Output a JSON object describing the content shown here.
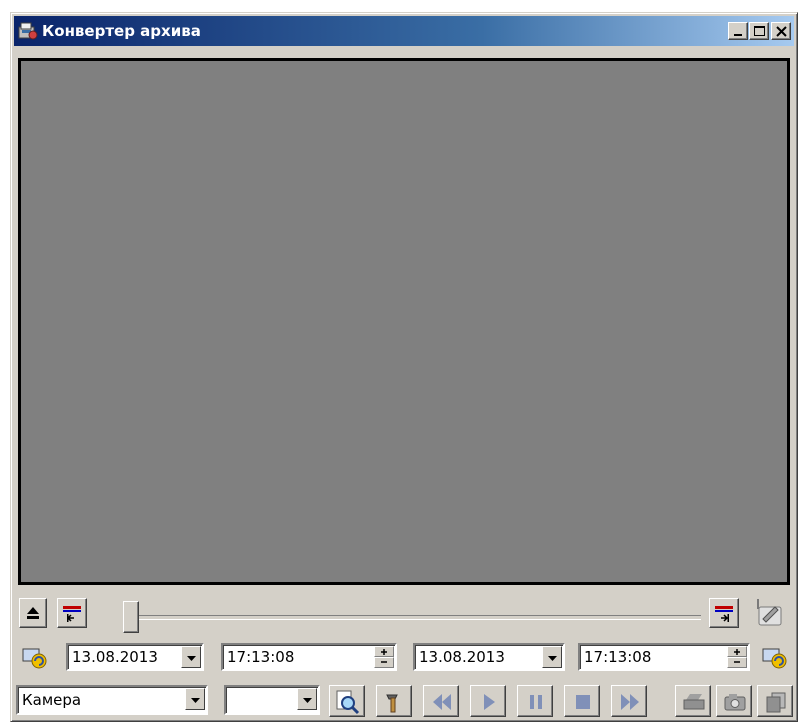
{
  "window": {
    "title": "Конвертер архива",
    "controls": [
      "minimize-icon",
      "maximize-icon",
      "close-icon"
    ]
  },
  "video": {
    "background": "#808080"
  },
  "timeline": {
    "position": 0.0
  },
  "range": {
    "start_date": "13.08.2013",
    "start_time": "17:13:08",
    "end_date": "13.08.2013",
    "end_time": "17:13:08"
  },
  "bottom": {
    "camera_selected": "Камера",
    "second_select_value": ""
  },
  "icons": {
    "eject": "eject-icon",
    "set_start": "set-start-marker-icon",
    "set_end": "set-end-marker-icon",
    "edit": "edit-icon",
    "refresh_start": "refresh-icon",
    "refresh_end": "refresh-icon",
    "search": "search-icon",
    "settings": "settings-icon",
    "rewind": "rewind-icon",
    "play": "play-icon",
    "pause": "pause-icon",
    "stop": "stop-icon",
    "fast_forward": "fast-forward-icon",
    "print": "print-icon",
    "snapshot": "camera-icon",
    "copy": "copy-icon"
  }
}
